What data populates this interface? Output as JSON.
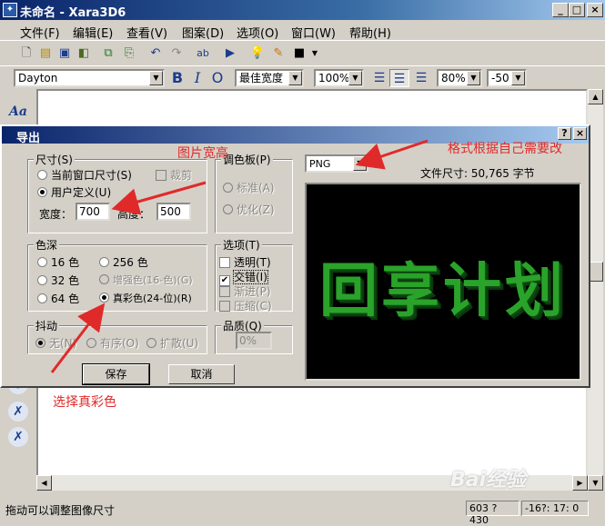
{
  "window": {
    "title": "未命名 - Xara3D6",
    "controls": [
      "_",
      "□",
      "×"
    ]
  },
  "menu": [
    "文件(F)",
    "编辑(E)",
    "查看(V)",
    "图案(D)",
    "选项(O)",
    "窗口(W)",
    "帮助(H)"
  ],
  "toolbar2": {
    "font": "Dayton",
    "bold": "B",
    "italic": "I",
    "outline": "O",
    "width_mode": "最佳宽度",
    "zoom": "100%",
    "line_spacing": "80%",
    "char_spacing": "-50"
  },
  "dialog": {
    "title": "导出",
    "help": "?",
    "close": "×",
    "size": {
      "legend": "尺寸(S)",
      "current_window": "当前窗口尺寸(S)",
      "custom": "用户定义(U)",
      "crop": "裁剪",
      "width_label": "宽度：",
      "width_value": "700",
      "height_label": "高度：",
      "height_value": "500"
    },
    "palette": {
      "legend": "调色板(P)",
      "standard": "标准(A)",
      "optimized": "优化(Z)"
    },
    "color_depth": {
      "legend": "色深",
      "c16": "16 色",
      "c256": "256 色",
      "c32": "32 色",
      "enhanced": "增强色(16-色)(G)",
      "c64": "64 色",
      "truecolor": "真彩色(24-位)(R)"
    },
    "options": {
      "legend": "选项(T)",
      "transparent": "透明(T)",
      "interlaced": "交错(I)",
      "progressive": "渐进(P)",
      "compress": "压缩(C)"
    },
    "dither": {
      "legend": "抖动",
      "none": "无(N)",
      "ordered": "有序(O)",
      "diffuse": "扩散(U)"
    },
    "quality": {
      "legend": "品质(Q)",
      "value": "0%"
    },
    "format": "PNG",
    "file_size": "文件尺寸: 50,765 字节",
    "preview_text": "回享计划",
    "save_button": "保存",
    "cancel_button": "取消"
  },
  "annotations": {
    "format_note": "格式根据自己需要改",
    "size_note": "图片宽高",
    "truecolor_note": "选择真彩色"
  },
  "status": {
    "message": "拖动可以调整图像尺寸",
    "dims": "603 ?430",
    "angles": "-16?: 17: 0"
  },
  "watermark": "Bai经验",
  "colors": {
    "title_bar": "#0a246a",
    "annotation_red": "#e02a2a",
    "preview_green": "#2aa32a"
  }
}
